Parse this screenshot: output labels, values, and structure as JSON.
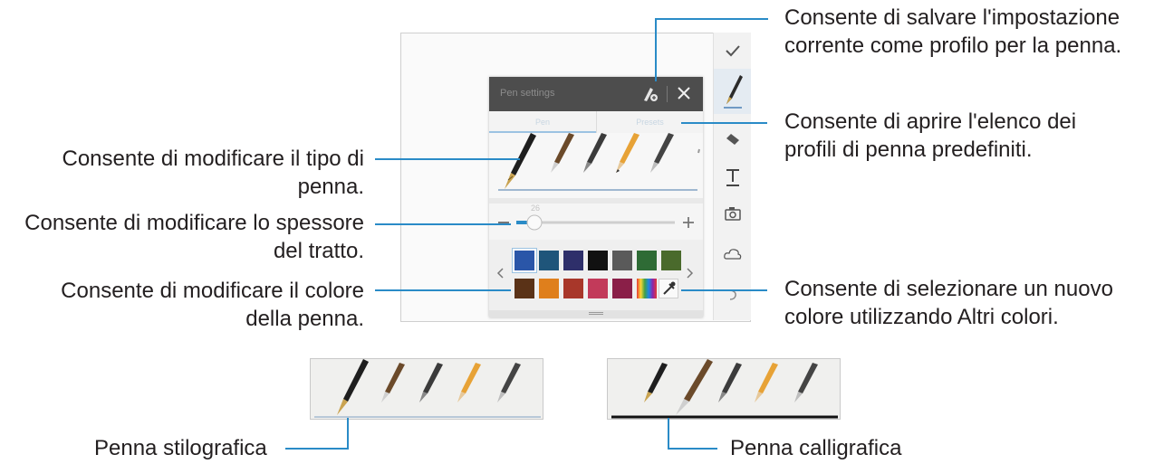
{
  "callouts": {
    "save_profile": "Consente di salvare l'impostazione\ncorrente come profilo per la penna.",
    "open_profiles": "Consente di aprire l'elenco dei\nprofili di penna predefiniti.",
    "new_color": "Consente di selezionare un nuovo\ncolore utilizzando Altri colori.",
    "pen_type": "Consente di modificare il tipo di\npenna.",
    "stroke_width": "Consente di modificare lo spessore\ndel tratto.",
    "pen_color": "Consente di modificare il colore\ndella penna.",
    "fountain_pen": "Penna stilografica",
    "calligraphy_pen": "Penna calligrafica"
  },
  "panel": {
    "title": "Pen settings",
    "tabs": [
      "Pen",
      "Presets"
    ],
    "size_value": "26"
  },
  "colors": {
    "row1": [
      "#2a56a8",
      "#1f557a",
      "#2e2f6a",
      "#111111",
      "#5a5a5a",
      "#2e6b35",
      "#4a6a2c"
    ],
    "row2": [
      "#5a3217",
      "#df7f1c",
      "#a8372a",
      "#c23a5a",
      "#8a1f48"
    ],
    "accent": "#2a8bc7"
  },
  "icons": [
    "check-icon",
    "pen-icon",
    "eraser-icon",
    "text-icon",
    "camera-icon",
    "lasso-icon",
    "undo-icon",
    "close-icon",
    "save-pen-icon",
    "eyedropper-icon",
    "chevron-left-icon",
    "chevron-right-icon",
    "minus-icon",
    "plus-icon"
  ]
}
